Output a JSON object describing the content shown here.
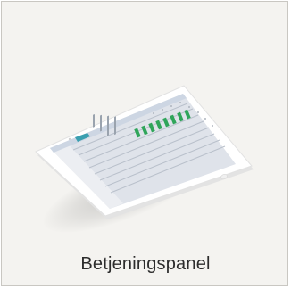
{
  "card": {
    "caption": "Betjeningspanel"
  },
  "colors": {
    "card_background": "#f4f3f0",
    "card_border": "#c9c7c2",
    "tablet_body": "#ffffff",
    "tablet_edge": "#dcdcdc",
    "screen_background": "#dfe3ea",
    "screen_sidebar": "#eceef2",
    "screen_header": "#cdd6e3",
    "accent": "#2fa55a",
    "caption_text": "#2c2c2c"
  }
}
